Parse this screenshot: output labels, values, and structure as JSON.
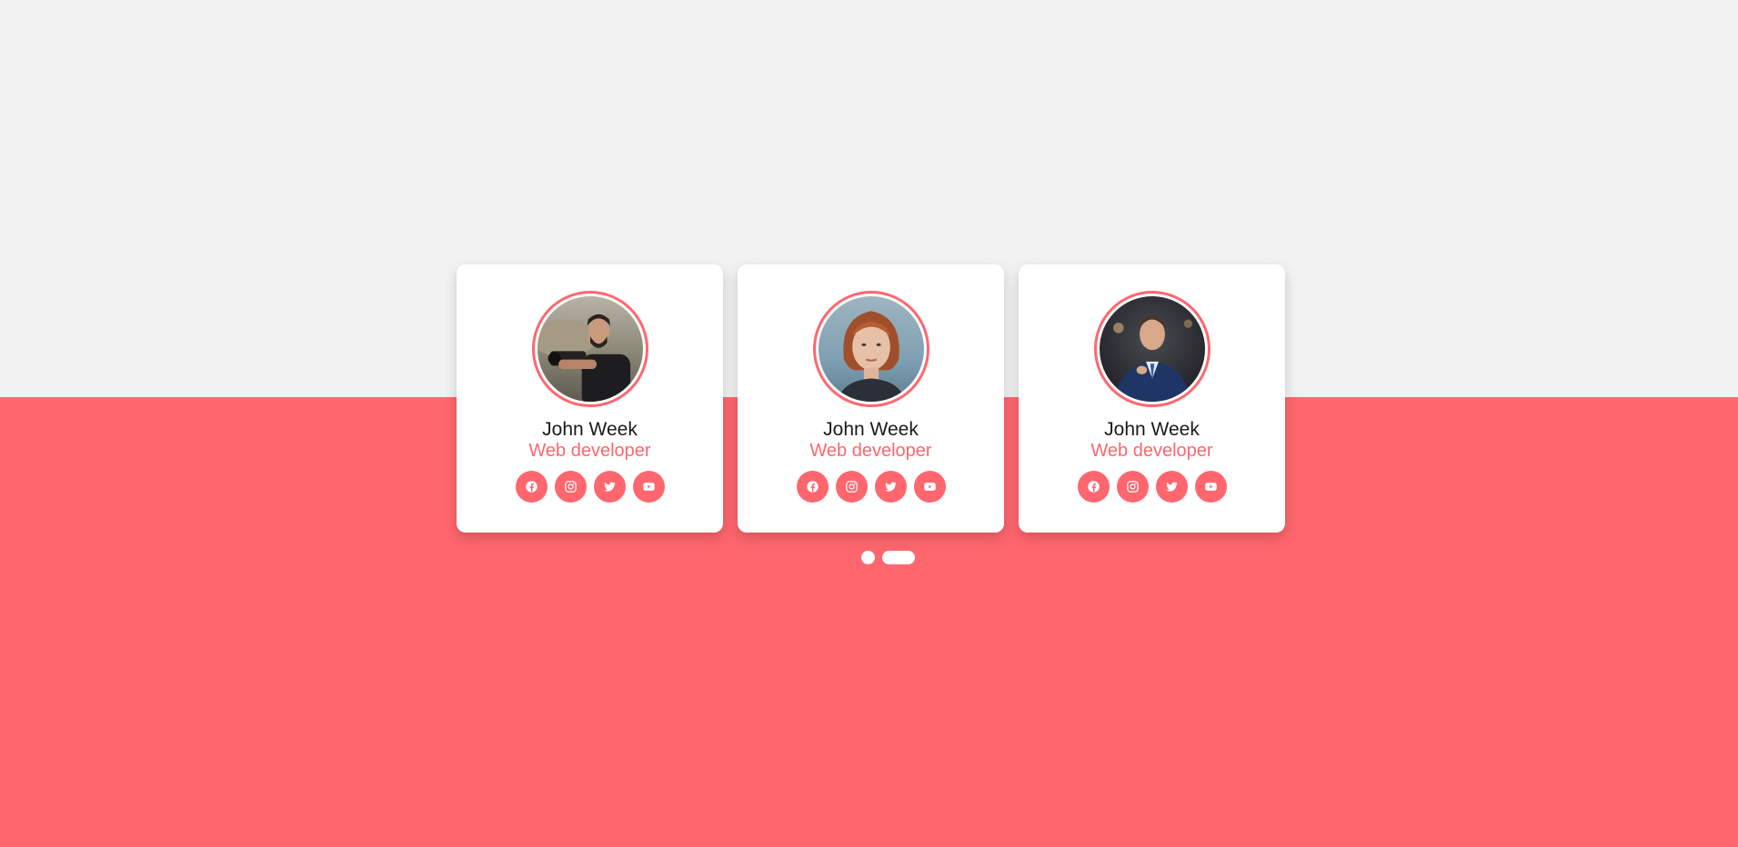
{
  "colors": {
    "accent": "#ff666e",
    "background_top": "#f2f2f2",
    "card": "#ffffff",
    "text": "#1a1a1a"
  },
  "cards": [
    {
      "name": "John Week",
      "role": "Web developer",
      "avatar": "man-with-camera-photo",
      "socials": [
        "facebook-icon",
        "instagram-icon",
        "twitter-icon",
        "youtube-icon"
      ]
    },
    {
      "name": "John Week",
      "role": "Web developer",
      "avatar": "red-haired-woman-photo",
      "socials": [
        "facebook-icon",
        "instagram-icon",
        "twitter-icon",
        "youtube-icon"
      ]
    },
    {
      "name": "John Week",
      "role": "Web developer",
      "avatar": "man-in-suit-photo",
      "socials": [
        "facebook-icon",
        "instagram-icon",
        "twitter-icon",
        "youtube-icon"
      ]
    }
  ],
  "pagination": {
    "page_count": 2,
    "active_page": 2
  }
}
